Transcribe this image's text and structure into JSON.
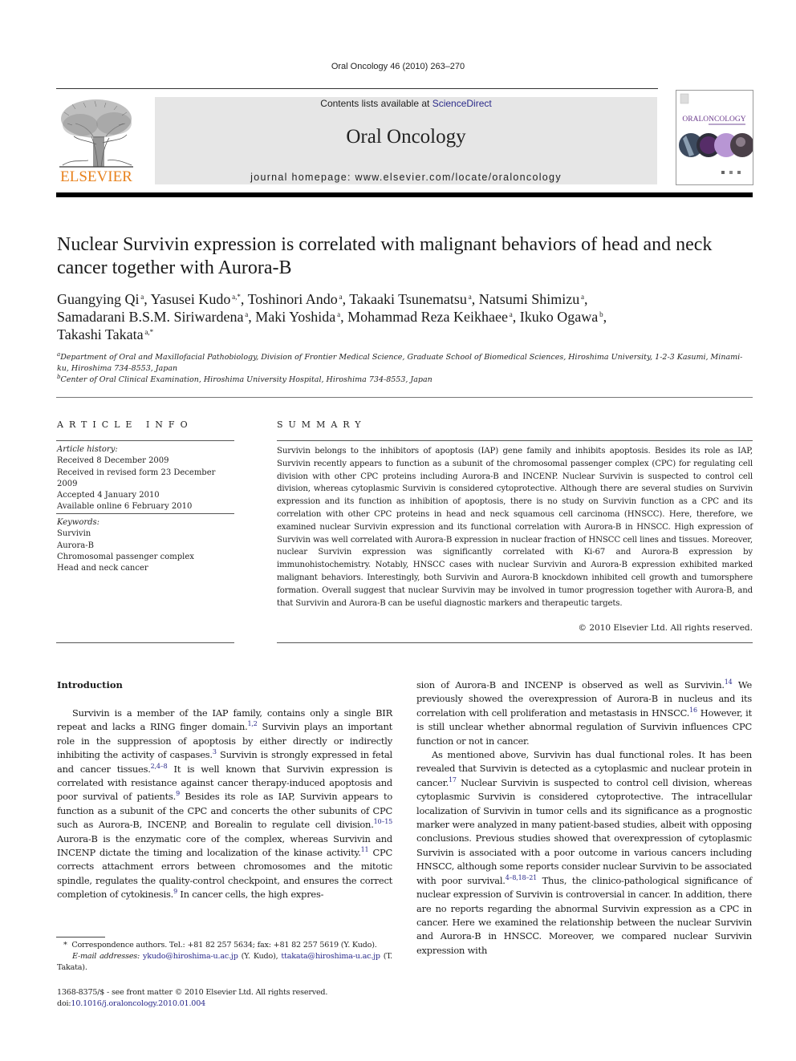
{
  "running_head": "Oral Oncology 46 (2010) 263–270",
  "header": {
    "publisher_logo_text": "ELSEVIER",
    "contents_prefix": "Contents lists available at ",
    "contents_link": "ScienceDirect",
    "journal_name": "Oral Oncology",
    "homepage_prefix": "journal homepage: ",
    "homepage_url": "www.elsevier.com/locate/oraloncology",
    "cover": {
      "title_part1": "ORAL",
      "title_part2": "ONCOLOGY",
      "accent_color": "#6b3a8c"
    },
    "logo_color": "#e8821e",
    "link_color": "#2a2a8a"
  },
  "article": {
    "title": "Nuclear Survivin expression is correlated with malignant behaviors of head and neck cancer together with Aurora-B",
    "authors": [
      {
        "name": "Guangying Qi",
        "aff": "a",
        "sep": ", "
      },
      {
        "name": "Yasusei Kudo",
        "aff": "a,*",
        "sep": ", "
      },
      {
        "name": "Toshinori Ando",
        "aff": "a",
        "sep": ", "
      },
      {
        "name": "Takaaki Tsunematsu",
        "aff": "a",
        "sep": ", "
      },
      {
        "name": "Natsumi Shimizu",
        "aff": "a",
        "sep": ","
      },
      {
        "name": "Samadarani B.S.M. Siriwardena",
        "aff": "a",
        "sep": ", "
      },
      {
        "name": "Maki Yoshida",
        "aff": "a",
        "sep": ", "
      },
      {
        "name": "Mohammad Reza Keikhaee",
        "aff": "a",
        "sep": ", "
      },
      {
        "name": "Ikuko Ogawa",
        "aff": "b",
        "sep": ","
      },
      {
        "name": "Takashi Takata",
        "aff": "a,*",
        "sep": ""
      }
    ],
    "affiliations": [
      {
        "key": "a",
        "text": "Department of Oral and Maxillofacial Pathobiology, Division of Frontier Medical Science, Graduate School of Biomedical Sciences, Hiroshima University, 1-2-3 Kasumi, Minami-ku, Hiroshima 734-8553, Japan"
      },
      {
        "key": "b",
        "text": "Center of Oral Clinical Examination, Hiroshima University Hospital, Hiroshima 734-8553, Japan"
      }
    ]
  },
  "article_info": {
    "heading": "ARTICLE INFO",
    "history_label": "Article history:",
    "history": [
      "Received 8 December 2009",
      "Received in revised form 23 December 2009",
      "Accepted 4 January 2010",
      "Available online 6 February 2010"
    ],
    "keywords_label": "Keywords:",
    "keywords": [
      "Survivin",
      "Aurora-B",
      "Chromosomal passenger complex",
      "Head and neck cancer"
    ]
  },
  "summary": {
    "heading": "SUMMARY",
    "text": "Survivin belongs to the inhibitors of apoptosis (IAP) gene family and inhibits apoptosis. Besides its role as IAP, Survivin recently appears to function as a subunit of the chromosomal passenger complex (CPC) for regulating cell division with other CPC proteins including Aurora-B and INCENP. Nuclear Survivin is suspected to control cell division, whereas cytoplasmic Survivin is considered cytoprotective. Although there are several studies on Survivin expression and its function as inhibition of apoptosis, there is no study on Survivin function as a CPC and its correlation with other CPC proteins in head and neck squamous cell carcinoma (HNSCC). Here, therefore, we examined nuclear Survivin expression and its functional correlation with Aurora-B in HNSCC. High expression of Survivin was well correlated with Aurora-B expression in nuclear fraction of HNSCC cell lines and tissues. Moreover, nuclear Survivin expression was significantly correlated with Ki-67 and Aurora-B expression by immunohistochemistry. Notably, HNSCC cases with nuclear Survivin and Aurora-B expression exhibited marked malignant behaviors. Interestingly, both Survivin and Aurora-B knockdown inhibited cell growth and tumorsphere formation. Overall suggest that nuclear Survivin may be involved in tumor progression together with Aurora-B, and that Survivin and Aurora-B can be useful diagnostic markers and therapeutic targets.",
    "copyright": "© 2010 Elsevier Ltd. All rights reserved."
  },
  "introduction": {
    "heading": "Introduction",
    "left_paragraph": [
      {
        "t": "Survivin is a member of the IAP family, contains only a single BIR repeat and lacks a RING finger domain."
      },
      {
        "ref": "1,2"
      },
      {
        "t": " Survivin plays an important role in the suppression of apoptosis by either directly or indirectly inhibiting the activity of caspases."
      },
      {
        "ref": "3"
      },
      {
        "t": " Survivin is strongly expressed in fetal and cancer tissues."
      },
      {
        "ref": "2,4–8"
      },
      {
        "t": " It is well known that Survivin expression is correlated with resistance against cancer therapy-induced apoptosis and poor survival of patients."
      },
      {
        "ref": "9"
      },
      {
        "t": " Besides its role as IAP, Survivin appears to function as a subunit of the CPC and concerts the other subunits of CPC such as Aurora-B, INCENP, and Borealin to regulate cell division."
      },
      {
        "ref": "10–15"
      },
      {
        "t": " Aurora-B is the enzymatic core of the complex, whereas Survivin and INCENP dictate the timing and localization of the kinase activity."
      },
      {
        "ref": "11"
      },
      {
        "t": " CPC corrects attachment errors between chromosomes and the mitotic spindle, regulates the quality-control checkpoint, and ensures the correct completion of cytokinesis."
      },
      {
        "ref": "9"
      },
      {
        "t": " In cancer cells, the high expres-"
      }
    ],
    "right_paragraph_1": [
      {
        "t": "sion of Aurora-B and INCENP is observed as well as Survivin."
      },
      {
        "ref": "14"
      },
      {
        "t": " We previously showed the overexpression of Aurora-B in nucleus and its correlation with cell proliferation and metastasis in HNSCC."
      },
      {
        "ref": "16"
      },
      {
        "t": " However, it is still unclear whether abnormal regulation of Survivin influences CPC function or not in cancer."
      }
    ],
    "right_paragraph_2": [
      {
        "t": "As mentioned above, Survivin has dual functional roles. It has been revealed that Survivin is detected as a cytoplasmic and nuclear protein in cancer."
      },
      {
        "ref": "17"
      },
      {
        "t": " Nuclear Survivin is suspected to control cell division, whereas cytoplasmic Survivin is considered cytoprotective. The intracellular localization of Survivin in tumor cells and its significance as a prognostic marker were analyzed in many patient-based studies, albeit with opposing conclusions. Previous studies showed that overexpression of cytoplasmic Survivin is associated with a poor outcome in various cancers including HNSCC, although some reports consider nuclear Survivin to be associated with poor survival."
      },
      {
        "ref": "4–8,18–21"
      },
      {
        "t": " Thus, the clinico-pathological significance of nuclear expression of Survivin is controversial in cancer. In addition, there are no reports regarding the abnormal Survivin expression as a CPC in cancer. Here we examined the relationship between the nuclear Survivin and Aurora-B in HNSCC. Moreover, we compared nuclear Survivin expression with"
      }
    ]
  },
  "footnote": {
    "star": "*",
    "correspondence": "Correspondence authors. Tel.: +81 82 257 5634; fax: +81 82 257 5619 (Y. Kudo).",
    "email_label": "E-mail addresses:",
    "email1": "ykudo@hiroshima-u.ac.jp",
    "email1_owner": " (Y. Kudo), ",
    "email2": "ttakata@hiroshima-u.ac.jp",
    "email2_owner": " (T. Takata)."
  },
  "front_matter": {
    "issn_line": "1368-8375/$ - see front matter © 2010 Elsevier Ltd. All rights reserved.",
    "doi_prefix": "doi:",
    "doi": "10.1016/j.oraloncology.2010.01.004"
  }
}
